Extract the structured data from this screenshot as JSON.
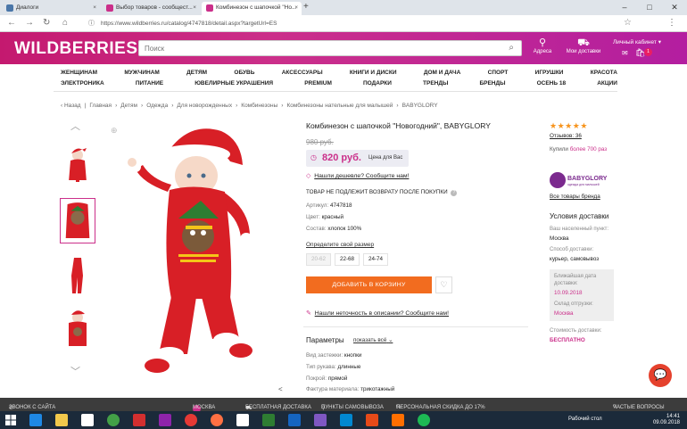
{
  "browser": {
    "tabs": [
      {
        "title": "Диалоги",
        "color": "#4a76a8"
      },
      {
        "title": "Выбор товаров - сообщест...",
        "color": "#cb2f8a"
      },
      {
        "title": "Комбинезон с шапочкой \"Но...",
        "color": "#cb2f8a"
      }
    ],
    "url": "https://www.wildberries.ru/catalog/4747818/detail.aspx?targetUrl=ES"
  },
  "header": {
    "logo": "WILDBERRIES",
    "search_placeholder": "Поиск",
    "addresses": "Адреса",
    "delivery": "Мои доставки",
    "cabinet": "Личный кабинет",
    "cart_count": "1"
  },
  "categories": {
    "row1": [
      "ЖЕНЩИНАМ",
      "МУЖЧИНАМ",
      "ДЕТЯМ",
      "ОБУВЬ",
      "АКСЕССУАРЫ",
      "КНИГИ И ДИСКИ",
      "ДОМ И ДАЧА",
      "СПОРТ",
      "ИГРУШКИ",
      "КРАСОТА"
    ],
    "row2": [
      "ЭЛЕКТРОНИКА",
      "ПИТАНИЕ",
      "ЮВЕЛИРНЫЕ УКРАШЕНИЯ",
      "PREMIUM",
      "ПОДАРКИ",
      "ТРЕНДЫ",
      "БРЕНДЫ",
      "ОСЕНЬ 18",
      "АКЦИИ"
    ]
  },
  "breadcrumbs": [
    "Назад",
    "Главная",
    "Детям",
    "Одежда",
    "Для новорожденных",
    "Комбинезоны",
    "Комбинезоны нательные для малышей",
    "BABYGLORY"
  ],
  "product": {
    "title": "Комбинезон с шапочкой \"Новогодний\", BABYGLORY",
    "old_price": "980 руб.",
    "price": "820 руб.",
    "price_note": "Цена для Вас",
    "cheaper_link": "Нашли дешевле? Сообщите нам!",
    "no_return": "ТОВАР НЕ ПОДЛЕЖИТ ВОЗВРАТУ ПОСЛЕ ПОКУПКИ",
    "props": [
      {
        "label": "Артикул:",
        "value": "4747818"
      },
      {
        "label": "Цвет:",
        "value": "красный"
      },
      {
        "label": "Состав:",
        "value": "хлопок 100%"
      }
    ],
    "size_link": "Определите свой размер",
    "sizes": [
      {
        "label": "20-62",
        "available": false
      },
      {
        "label": "22-68",
        "available": true
      },
      {
        "label": "24-74",
        "available": true
      }
    ],
    "add_to_cart": "ДОБАВИТЬ В КОРЗИНУ",
    "inaccuracy_link": "Нашли неточность в описании? Сообщите нам!",
    "params_title": "Параметры",
    "show_all": "показать всё",
    "params": [
      {
        "label": "Вид застежки:",
        "value": "кнопки"
      },
      {
        "label": "Тип рукава:",
        "value": "длинные"
      },
      {
        "label": "Покрой:",
        "value": "прямой"
      },
      {
        "label": "Фактура материала:",
        "value": "трикотажный"
      }
    ]
  },
  "sidebar": {
    "rating_stars": 5,
    "reviews": "Отзывов: 36",
    "bought_prefix": "Купили",
    "bought_value": "более 700 раз",
    "brand": "BABYGLORY",
    "brand_sub": "одежда для малышей",
    "all_brand": "Все товары бренда",
    "delivery_title": "Условия доставки",
    "city_label": "Ваш населенный пункт:",
    "city": "Москва",
    "method_label": "Способ доставки:",
    "method": "курьер, самовывоз",
    "nearest_label": "Ближайшая дата доставки:",
    "nearest": "10.09.2018",
    "warehouse_label": "Склад отгрузки:",
    "warehouse": "Москва",
    "cost_label": "Стоимость доставки:",
    "cost": "БЕСПЛАТНО"
  },
  "promobar": {
    "call": "ЗВОНОК С САЙТА",
    "city": "МОСКВА",
    "free_delivery": "БЕСПЛАТНАЯ ДОСТАВКА",
    "pickup": "ПУНКТЫ САМОВЫВОЗА",
    "discount": "ПЕРСОНАЛЬНАЯ СКИДКА ДО 17%",
    "faq": "ЧАСТЫЕ ВОПРОСЫ"
  },
  "taskbar": {
    "desktop": "Рабочий стол",
    "time": "14:41",
    "date": "09.09.2018"
  },
  "colors": {
    "brand": "#cb2f8a",
    "cart_button": "#f26c1f"
  }
}
